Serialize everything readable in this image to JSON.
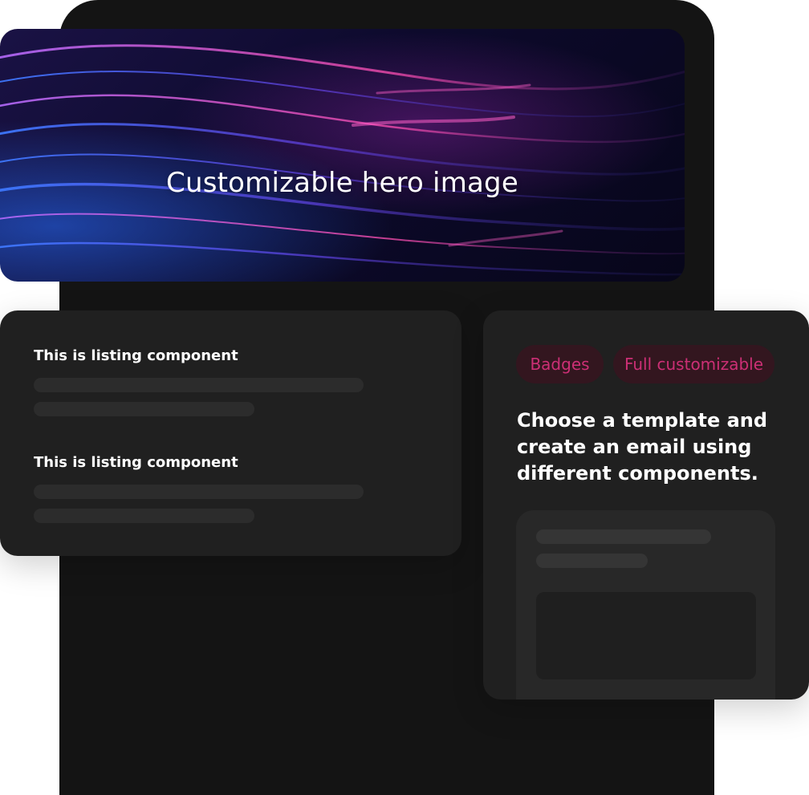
{
  "hero": {
    "title": "Customizable hero image"
  },
  "listing": {
    "items": [
      {
        "title": "This is listing component"
      },
      {
        "title": "This is listing component"
      }
    ]
  },
  "side_card": {
    "badges": [
      {
        "label": "Badges"
      },
      {
        "label": "Full customizable"
      }
    ],
    "heading": "Choose a template and create an email using different components."
  },
  "colors": {
    "background": "#ffffff",
    "device": "#141414",
    "card": "#202020",
    "placeholder_bar": "#2c2c2c",
    "badge_bg": "#33161f",
    "badge_text": "#cc2f75"
  }
}
